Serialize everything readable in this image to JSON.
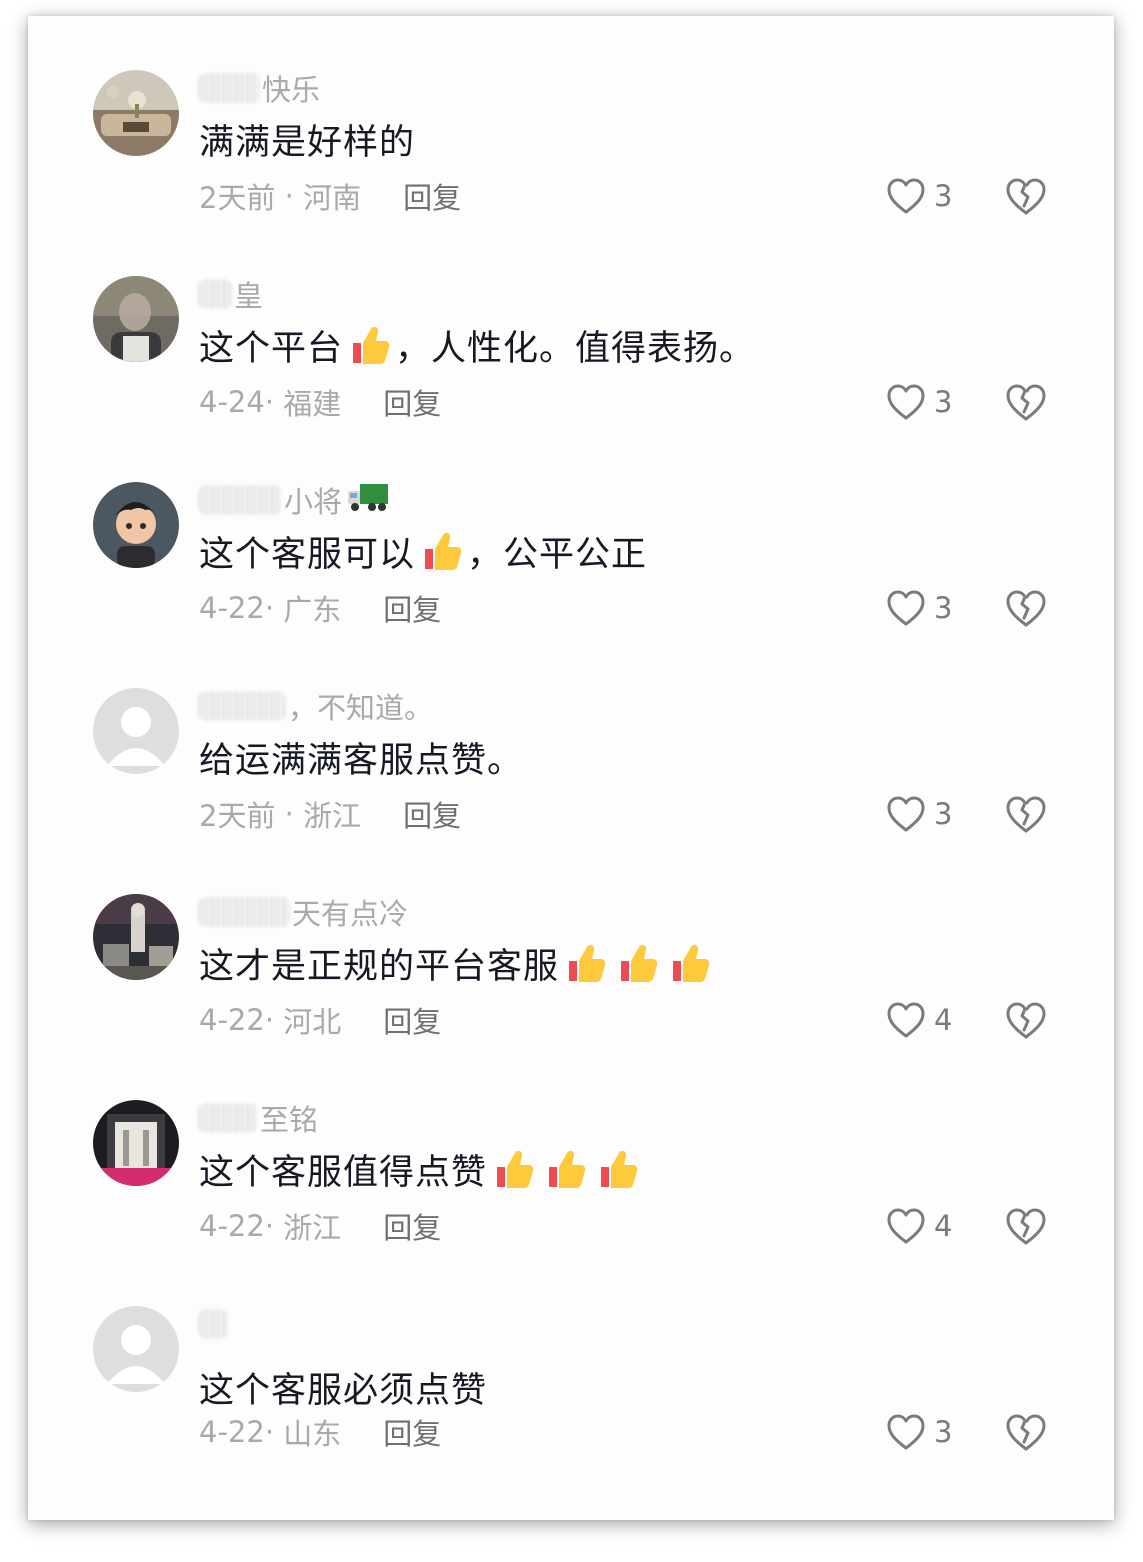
{
  "comments": [
    {
      "username_visible": "快乐",
      "avatar": "living-room-avatar",
      "text": "满满是好样的",
      "thumbs": 0,
      "text_suffix": "",
      "date": "2天前",
      "location": "河南",
      "reply_label": "回复",
      "likes": "3"
    },
    {
      "username_visible": "皇",
      "avatar": "person-photo-avatar",
      "text": "这个平台",
      "thumbs": 1,
      "text_suffix": "，人性化。值得表扬。",
      "date": "4-24",
      "location": "福建",
      "reply_label": "回复",
      "likes": "3"
    },
    {
      "username_visible": "小将",
      "avatar": "cartoon-boy-avatar",
      "name_icon": "truck-icon",
      "text": "这个客服可以",
      "thumbs": 1,
      "text_suffix": "，公平公正",
      "date": "4-22",
      "location": "广东",
      "reply_label": "回复",
      "likes": "3"
    },
    {
      "username_visible": "，不知道。",
      "avatar": "default-avatar",
      "text": "给运满满客服点赞。",
      "thumbs": 0,
      "text_suffix": "",
      "date": "2天前",
      "location": "浙江",
      "reply_label": "回复",
      "likes": "3"
    },
    {
      "username_visible": "天有点冷",
      "avatar": "statue-scene-avatar",
      "text": "这才是正规的平台客服",
      "thumbs": 3,
      "text_suffix": "",
      "date": "4-22",
      "location": "河北",
      "reply_label": "回复",
      "likes": "4"
    },
    {
      "username_visible": "至铭",
      "avatar": "building-entrance-avatar",
      "text": "这个客服值得点赞",
      "thumbs": 3,
      "text_suffix": "",
      "date": "4-22",
      "location": "浙江",
      "reply_label": "回复",
      "likes": "4"
    },
    {
      "username_visible": "",
      "avatar": "default-avatar",
      "text": "这个客服必须点赞",
      "thumbs": 0,
      "text_suffix": "",
      "date": "4-22",
      "location": "山东",
      "reply_label": "回复",
      "likes": "3"
    }
  ],
  "colors": {
    "text": "#161823",
    "meta": "#a9a9ad",
    "reply": "#6f6f74",
    "icon": "#7a7a7f"
  }
}
